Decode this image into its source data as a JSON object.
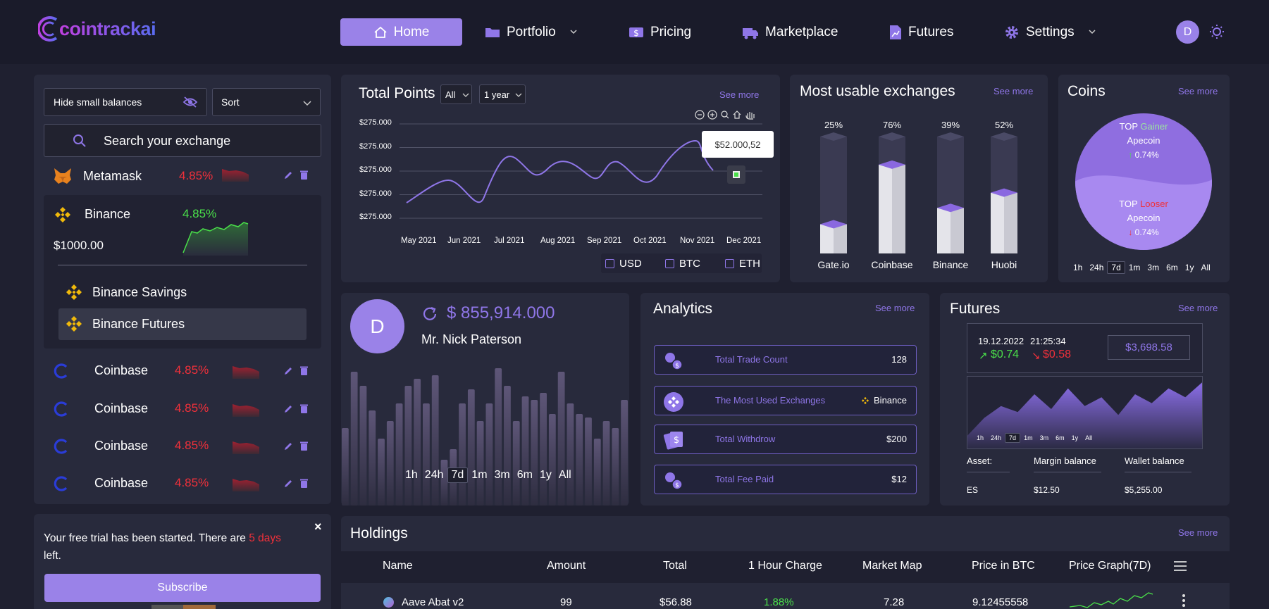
{
  "brand": {
    "logo_text": "cointrackai"
  },
  "nav": {
    "home": "Home",
    "portfolio": "Portfolio",
    "pricing": "Pricing",
    "marketplace": "Marketplace",
    "futures": "Futures",
    "settings": "Settings",
    "avatar_initial": "D"
  },
  "sidebar": {
    "hide_small": "Hide small balances",
    "sort": "Sort",
    "search_placeholder": "Search your exchange",
    "metamask": {
      "name": "Metamask",
      "pct": "4.85%"
    },
    "binance": {
      "name": "Binance",
      "pct": "4.85%",
      "balance": "$1000.00",
      "sub": [
        "Binance Savings",
        "Binance Futures"
      ]
    },
    "coinbase_rows": [
      {
        "name": "Coinbase",
        "pct": "4.85%"
      },
      {
        "name": "Coinbase",
        "pct": "4.85%"
      },
      {
        "name": "Coinbase",
        "pct": "4.85%"
      },
      {
        "name": "Coinbase",
        "pct": "4.85%"
      }
    ]
  },
  "trial": {
    "text_before": "Your free trial has been started. There are ",
    "days": "5 days",
    "text_after": "left.",
    "close": "×",
    "subscribe": "Subscribe"
  },
  "total_points": {
    "title": "Total Points",
    "filter": "All",
    "range": "1 year",
    "see_more": "See more",
    "tooltip": "$52.000,52",
    "currencies": [
      "USD",
      "BTC",
      "ETH"
    ],
    "chart_data": {
      "type": "line",
      "x": [
        "May 2021",
        "Jun 2021",
        "Jul 2021",
        "Aug 2021",
        "Sep 2021",
        "Oct 2021",
        "Nov 2021",
        "Dec 2021"
      ],
      "ytick_labels": [
        "$275.000",
        "$275.000",
        "$275.000",
        "$275.000",
        "$275.000"
      ]
    }
  },
  "exchanges": {
    "title": "Most usable exchanges",
    "see_more": "See more",
    "chart_data": {
      "type": "bar",
      "categories": [
        "Gate.io",
        "Coinbase",
        "Binance",
        "Huobi"
      ],
      "values": [
        25,
        76,
        39,
        52
      ],
      "labels": [
        "25%",
        "76%",
        "39%",
        "52%"
      ]
    }
  },
  "coins": {
    "title": "Coins",
    "see_more": "See more",
    "top_label": "TOP",
    "gainer": "Gainer",
    "gainer_coin": "Apecoin",
    "gainer_pct": "0.74%",
    "looser": "Looser",
    "looser_coin": "Apecoin",
    "looser_pct": "0.74%",
    "timeframes": [
      "1h",
      "24h",
      "7d",
      "1m",
      "3m",
      "6m",
      "1y",
      "All"
    ],
    "selected": "7d"
  },
  "profile": {
    "initial": "D",
    "balance": "$ 855,914.000",
    "name": "Mr. Nick Paterson",
    "timeframes": [
      "1h",
      "24h",
      "7d",
      "1m",
      "3m",
      "6m",
      "1y",
      "All"
    ],
    "selected": "7d",
    "chart_data": {
      "type": "bar",
      "values": [
        110,
        190,
        170,
        135,
        95,
        120,
        145,
        170,
        180,
        145,
        185,
        65,
        80,
        145,
        165,
        120,
        145,
        195,
        170,
        120,
        155,
        150,
        160,
        130,
        190,
        145,
        130,
        125,
        95,
        120,
        110,
        150
      ]
    }
  },
  "analytics": {
    "title": "Analytics",
    "see_more": "See more",
    "items": [
      {
        "label": "Total Trade Count",
        "value": "128"
      },
      {
        "label": "The Most Used Exchanges",
        "value": "Binance"
      },
      {
        "label": "Total Withdrow",
        "value": "$200"
      },
      {
        "label": "Total Fee Paid",
        "value": "$12"
      }
    ]
  },
  "futures": {
    "title": "Futures",
    "see_more": "See more",
    "date": "19.12.2022",
    "time": "21:25:34",
    "up": "$0.74",
    "down": "$0.58",
    "price": "$3,698.58",
    "timeframes": [
      "1h",
      "24h",
      "7d",
      "1m",
      "3m",
      "6m",
      "1y",
      "All"
    ],
    "selected": "7d",
    "asset_label": "Asset:",
    "margin_label": "Margin balance",
    "wallet_label": "Wallet balance",
    "asset": "ES",
    "margin": "$12.50",
    "wallet": "$5,255.00",
    "chart_data": {
      "type": "area",
      "values": [
        5,
        35,
        55,
        45,
        75,
        50,
        85,
        55,
        70,
        40,
        75,
        60,
        85,
        70,
        95
      ]
    }
  },
  "holdings": {
    "title": "Holdings",
    "see_more": "See more",
    "columns": [
      "Name",
      "Amount",
      "Total",
      "1 Hour Charge",
      "Market Map",
      "Price in BTC",
      "Price Graph(7D)"
    ],
    "row": {
      "name": "Aave Abat v2",
      "amount": "99",
      "total": "$56.88",
      "charge": "1.88%",
      "map": "7.28",
      "btc": "9.12455558"
    }
  },
  "colors": {
    "accent": "#9a82e8",
    "bg": "#1f2030",
    "panel": "#282a3c",
    "red": "#f0303a",
    "green": "#4ae04a"
  }
}
